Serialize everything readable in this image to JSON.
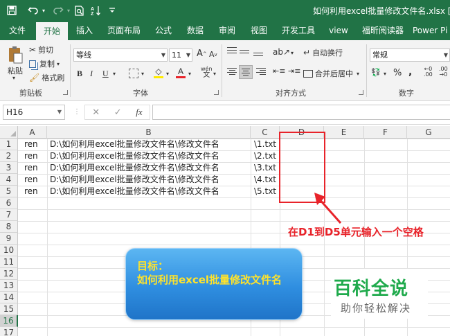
{
  "titlebar": {
    "document_title": "如何利用excel批量修改文件名.xlsx [用户",
    "qat": [
      "save-icon",
      "undo-icon",
      "redo-icon",
      "print-preview-icon",
      "sort-icon",
      "customize-icon"
    ]
  },
  "tabs": [
    {
      "label": "文件"
    },
    {
      "label": "开始"
    },
    {
      "label": "插入"
    },
    {
      "label": "页面布局"
    },
    {
      "label": "公式"
    },
    {
      "label": "数据"
    },
    {
      "label": "审阅"
    },
    {
      "label": "视图"
    },
    {
      "label": "开发工具"
    },
    {
      "label": "view"
    },
    {
      "label": "福昕阅读器"
    },
    {
      "label": "Power Pi"
    }
  ],
  "ribbon": {
    "clipboard": {
      "paste": "粘贴",
      "cut": "剪切",
      "copy": "复制",
      "format_painter": "格式刷",
      "label": "剪贴板"
    },
    "font": {
      "font_name": "等线",
      "font_size": "11",
      "bold": "B",
      "italic": "I",
      "underline": "U",
      "label": "字体",
      "grow": "A",
      "shrink": "A",
      "wen": "wén"
    },
    "alignment": {
      "wrap_text": "自动换行",
      "merge_center": "合并后居中",
      "label": "对齐方式"
    },
    "number": {
      "format": "常规",
      "percent": "%",
      "comma": ",",
      "label": "数字"
    }
  },
  "formula_bar": {
    "name_box": "H16",
    "cancel": "✕",
    "enter": "✓",
    "fx": "fx",
    "value": ""
  },
  "sheet": {
    "columns": [
      "A",
      "B",
      "C",
      "D",
      "E",
      "F",
      "G"
    ],
    "rows": [
      "1",
      "2",
      "3",
      "4",
      "5",
      "6",
      "7",
      "8",
      "9",
      "10",
      "11",
      "12",
      "13",
      "14",
      "15",
      "16",
      "17"
    ],
    "selected_row": "16",
    "data": [
      {
        "a": "ren",
        "b": "D:\\如何利用excel批量修改文件名\\修改文件名",
        "c": "\\1.txt"
      },
      {
        "a": "ren",
        "b": "D:\\如何利用excel批量修改文件名\\修改文件名",
        "c": "\\2.txt"
      },
      {
        "a": "ren",
        "b": "D:\\如何利用excel批量修改文件名\\修改文件名",
        "c": "\\3.txt"
      },
      {
        "a": "ren",
        "b": "D:\\如何利用excel批量修改文件名\\修改文件名",
        "c": "\\4.txt"
      },
      {
        "a": "ren",
        "b": "D:\\如何利用excel批量修改文件名\\修改文件名",
        "c": "\\5.txt"
      }
    ]
  },
  "annotations": {
    "instruction": "在D1到D5单元输入一个空格",
    "instruction_color": "#e8232a",
    "goal_line1": "目标：",
    "goal_line2": "如何利用excel批量修改文件名",
    "goal_color": "#ffe32b"
  },
  "watermark": {
    "main": "百科全说",
    "sub": "助你轻松解决",
    "color": "#1faa4c"
  },
  "theme": {
    "accent": "#217346"
  }
}
